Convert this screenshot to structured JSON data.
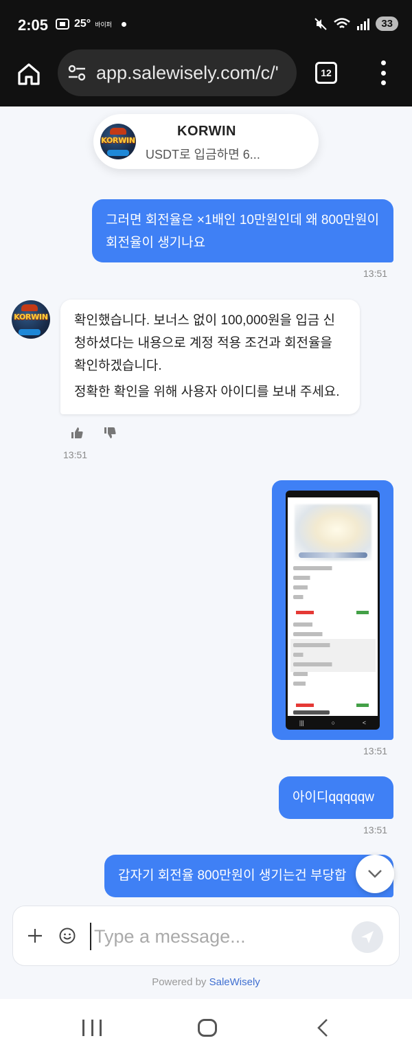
{
  "status_bar": {
    "time": "2:05",
    "temperature": "25°",
    "small_label": "바이퍼",
    "battery": "33"
  },
  "browser": {
    "url": "app.salewisely.com/c/'",
    "tab_count": "12"
  },
  "chat_header": {
    "name": "KORWIN",
    "subtitle": "USDT로 입금하면 6...",
    "avatar_logo_text": "KORWIN"
  },
  "messages": [
    {
      "direction": "outgoing",
      "text": "그러면 회전율은 ×1배인 10만원인데 왜 800만원이 회전율이 생기나요",
      "time": "13:51"
    },
    {
      "direction": "incoming",
      "paragraphs": [
        "확인했습니다. 보너스 없이 100,000원을 입금 신청하셨다는 내용으로 계정 적용 조건과 회전율을 확인하겠습니다.",
        "정확한 확인을 위해 사용자 아이디를 보내 주세요."
      ],
      "time": "13:51"
    },
    {
      "direction": "outgoing",
      "type": "image",
      "time": "13:51"
    },
    {
      "direction": "outgoing",
      "text": "아이디qqqqqw",
      "time": "13:51"
    },
    {
      "direction": "outgoing",
      "text": "갑자기 회전율 800만원이 생기는건 부당합"
    }
  ],
  "composer": {
    "placeholder": "Type a message...",
    "value": ""
  },
  "footer": {
    "powered_prefix": "Powered by",
    "powered_brand": "SaleWisely"
  },
  "icons": {
    "home": "home-icon",
    "site_settings": "site-settings-icon",
    "tabs": "tabs-icon",
    "menu": "more-vert-icon",
    "thumbs_up": "thumbs-up-icon",
    "thumbs_down": "thumbs-down-icon",
    "scroll_down": "chevron-down-icon",
    "plus": "plus-icon",
    "emoji": "emoji-icon",
    "send": "send-icon"
  },
  "colors": {
    "outgoing_bubble": "#3f80f5",
    "incoming_bubble": "#ffffff",
    "background": "#f5f7fb",
    "brand_link": "#3f6fd1"
  }
}
